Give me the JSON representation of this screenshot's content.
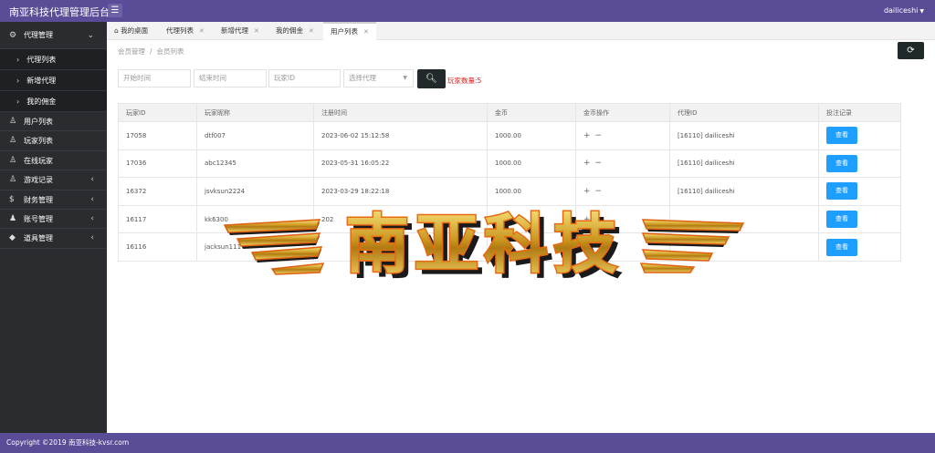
{
  "app": {
    "title": "南亚科技代理管理后台",
    "user": "dailiceshi",
    "menu_toggle_icon": "hamburger-icon"
  },
  "sidebar": {
    "group": {
      "label": "代理管理",
      "icon": "gear-icon"
    },
    "sub_items": [
      {
        "label": "代理列表"
      },
      {
        "label": "新增代理"
      },
      {
        "label": "我的佣金"
      }
    ],
    "items": [
      {
        "label": "用户列表",
        "icon": "user-icon",
        "has_arrow": false
      },
      {
        "label": "玩家列表",
        "icon": "user-icon",
        "has_arrow": false
      },
      {
        "label": "在线玩家",
        "icon": "user-icon",
        "has_arrow": false
      },
      {
        "label": "游戏记录",
        "icon": "user-icon",
        "has_arrow": true
      },
      {
        "label": "财务管理",
        "icon": "dollar-icon",
        "has_arrow": true
      },
      {
        "label": "账号管理",
        "icon": "users-icon",
        "has_arrow": true
      },
      {
        "label": "道具管理",
        "icon": "diamond-icon",
        "has_arrow": true
      }
    ]
  },
  "tabs": [
    {
      "label": "我的桌面",
      "closable": false
    },
    {
      "label": "代理列表",
      "closable": true
    },
    {
      "label": "新增代理",
      "closable": true
    },
    {
      "label": "我的佣金",
      "closable": true
    },
    {
      "label": "用户列表",
      "closable": true,
      "active": true
    }
  ],
  "breadcrumb": {
    "parent": "会员管理",
    "separator": "/",
    "current": "会员列表"
  },
  "filters": {
    "start_time_placeholder": "开始时间",
    "end_time_placeholder": "结束时间",
    "player_id_placeholder": "玩家ID",
    "agent_select_placeholder": "选择代理",
    "search_icon": "search-icon",
    "player_count": "玩家数量:5"
  },
  "table": {
    "headers": [
      "玩家ID",
      "玩家昵称",
      "注册时间",
      "金币",
      "金币操作",
      "代理ID",
      "投注记录"
    ],
    "ops": [
      "+",
      "−"
    ],
    "view_label": "查看",
    "rows": [
      {
        "id": "17058",
        "nick": "dtf007",
        "time": "2023-06-02 15:12:58",
        "gold": "1000.00",
        "agent": "[16110] dailiceshi"
      },
      {
        "id": "17036",
        "nick": "abc12345",
        "time": "2023-05-31 16:05:22",
        "gold": "1000.00",
        "agent": "[16110] dailiceshi"
      },
      {
        "id": "16372",
        "nick": "jsvksun2224",
        "time": "2023-03-29 18:22:18",
        "gold": "1000.00",
        "agent": "[16110] dailiceshi"
      },
      {
        "id": "16117",
        "nick": "kk6300",
        "time": "202",
        "gold": "",
        "agent": ""
      },
      {
        "id": "16116",
        "nick": "jacksun111",
        "time": "",
        "gold": "",
        "agent": ""
      }
    ]
  },
  "watermark": {
    "text": "南亚科技",
    "style": "gold-3d-winged-logo"
  },
  "footer": {
    "copyright": "Copyright ©2019 南亚科技-kvsr.com"
  },
  "colors": {
    "header": "#5a4c96",
    "sidebar": "#2b2c30",
    "primary_btn": "#1e9fff",
    "dark_btn": "#22292a",
    "count": "#e02020"
  }
}
